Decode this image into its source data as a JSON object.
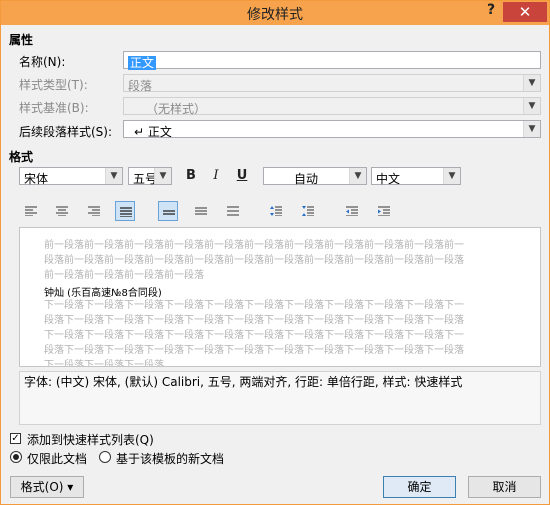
{
  "window": {
    "title": "修改样式",
    "help": "?",
    "close": "✕"
  },
  "properties": {
    "section_label": "属性",
    "name_label": "名称(N):",
    "name_value": "正文",
    "type_label": "样式类型(T):",
    "type_value": "段落",
    "base_label": "样式基准(B):",
    "base_value": "（无样式）",
    "next_label": "后续段落样式(S):",
    "next_value": "↵ 正文"
  },
  "format": {
    "section_label": "格式",
    "font": "宋体",
    "size": "五号",
    "bold": "B",
    "italic": "I",
    "underline": "U",
    "color": "自动",
    "script": "中文"
  },
  "preview": {
    "before_lines": [
      "前一段落前一段落前一段落前一段落前一段落前一段落前一段落前一段落前一段落前一段落前一",
      "段落前一段落前一段落前一段落前一段落前一段落前一段落前一段落前一段落前一段落前一段落",
      "前一段落前一段落前一段落前一段落"
    ],
    "sample": "钟灿 (乐百高速№8合同段)",
    "after_lines": [
      "下一段落下一段落下一段落下一段落下一段落下一段落下一段落下一段落下一段落下一段落下一",
      "段落下一段落下一段落下一段落下一段落下一段落下一段落下一段落下一段落下一段落下一段落",
      "下一段落下一段落下一段落下一段落下一段落下一段落下一段落下一段落下一段落下一段落下一",
      "段落下一段落下一段落下一段落下一段落下一段落下一段落下一段落下一段落下一段落下一段落",
      "下一段落下一段落下一段落"
    ]
  },
  "description": "字体: (中文) 宋体, (默认) Calibri, 五号, 两端对齐, 行距: 单倍行距, 样式: 快速样式",
  "options": {
    "add_quick": "添加到快速样式列表(Q)",
    "this_doc": "仅限此文档",
    "template": "基于该模板的新文档"
  },
  "buttons": {
    "format": "格式(O) ▾",
    "ok": "确定",
    "cancel": "取消"
  }
}
